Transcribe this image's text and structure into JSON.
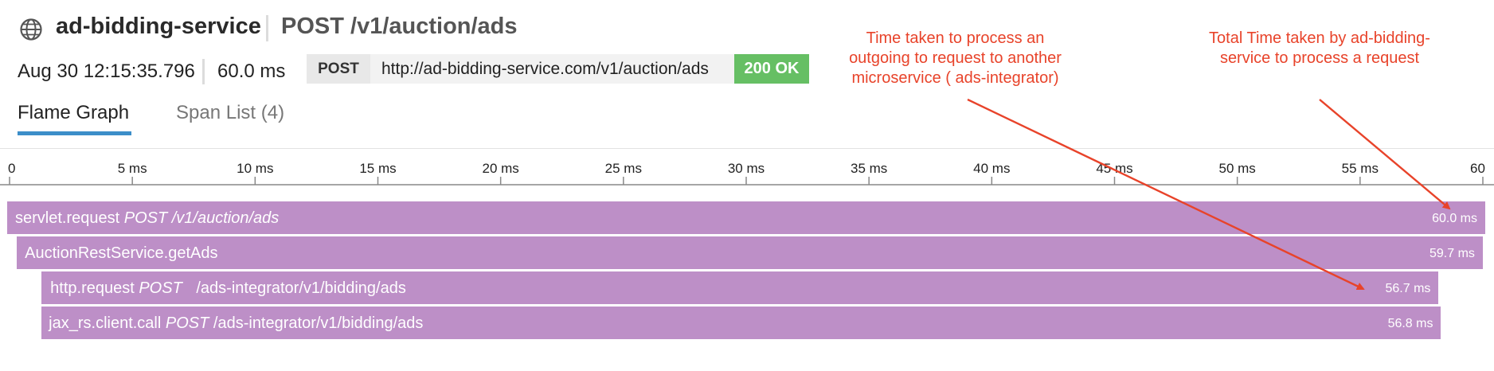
{
  "header": {
    "service_name": "ad-bidding-service",
    "endpoint": "POST /v1/auction/ads",
    "timestamp": "Aug 30 12:15:35.796",
    "duration": "60.0 ms",
    "method": "POST",
    "url": "http://ad-bidding-service.com/v1/auction/ads",
    "status": "200 OK",
    "icon": "globe-icon",
    "status_color": "#66bf64"
  },
  "tabs": [
    {
      "label": "Flame Graph",
      "active": true
    },
    {
      "label": "Span List (4)",
      "active": false
    }
  ],
  "ruler": {
    "ticks": [
      "0",
      "5 ms",
      "10 ms",
      "15 ms",
      "20 ms",
      "25 ms",
      "30 ms",
      "35 ms",
      "40 ms",
      "45 ms",
      "50 ms",
      "55 ms",
      "60"
    ]
  },
  "spans": [
    {
      "name": "servlet.request",
      "resource": "POST /v1/auction/ads",
      "duration": "60.0 ms",
      "start_ms": 0.0,
      "duration_ms": 60.0
    },
    {
      "name": "AuctionRestService.getAds",
      "resource": "",
      "duration": "59.7 ms",
      "start_ms": 0.2,
      "duration_ms": 59.7
    },
    {
      "name": "http.request",
      "method": "POST",
      "resource": "/ads-integrator/v1/bidding/ads",
      "duration": "56.7 ms",
      "start_ms": 1.4,
      "duration_ms": 56.7
    },
    {
      "name": "jax_rs.client.call",
      "method": "POST",
      "resource": "/ads-integrator/v1/bidding/ads",
      "duration": "56.8 ms",
      "start_ms": 1.4,
      "duration_ms": 56.8
    }
  ],
  "annotations": [
    {
      "text": "Time taken to process an outgoing to request to another microservice ( ads-integrator)"
    },
    {
      "text": "Total Time taken by ad-bidding-service to process a request"
    }
  ],
  "colors": {
    "span_fill": "#bd8fc7",
    "tab_accent": "#3c8ec9",
    "annotation": "#e8432a"
  }
}
